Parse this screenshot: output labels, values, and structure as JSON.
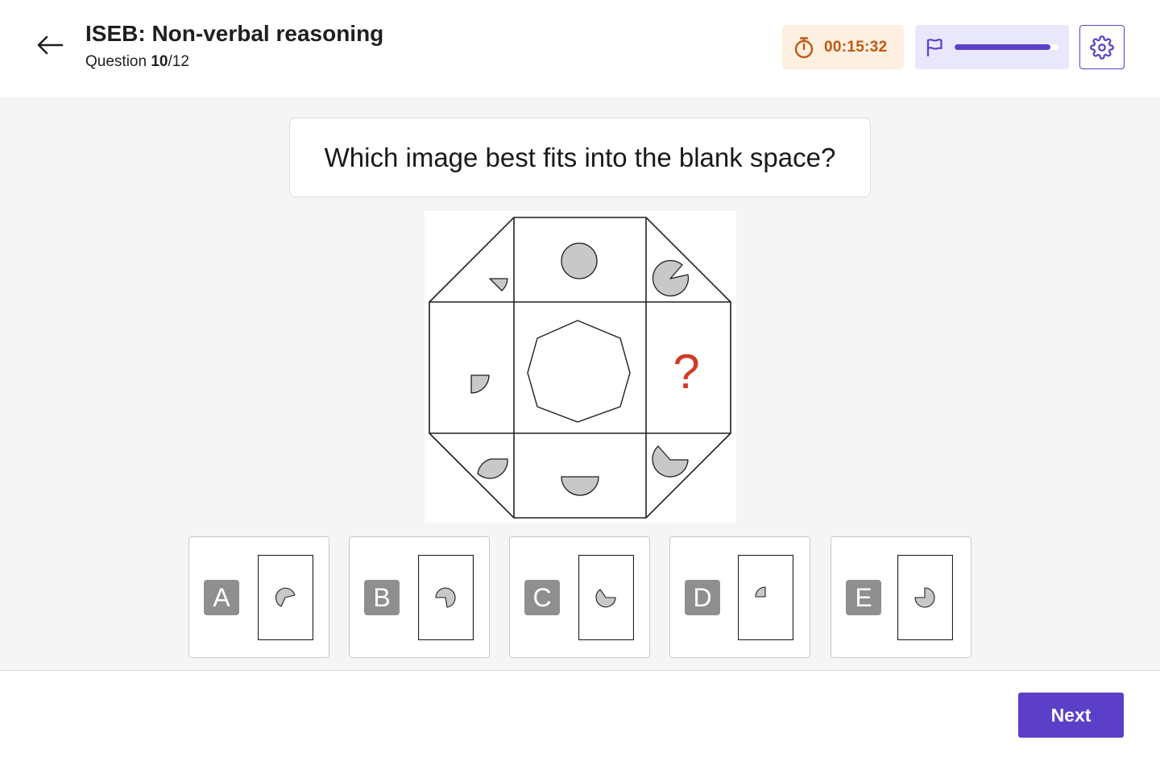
{
  "header": {
    "title": "ISEB: Non-verbal reasoning",
    "question_prefix": "Question",
    "question_current": "10",
    "question_total": "/12",
    "back_icon": "arrow-left-icon",
    "timer_icon": "stopwatch-icon",
    "timer": "00:15:32",
    "flag_icon": "flag-icon",
    "progress": 0.92,
    "settings_icon": "gear-icon"
  },
  "question": {
    "text": "Which image best fits into the blank space?",
    "missing_marker": "?"
  },
  "options": [
    {
      "letter": "A"
    },
    {
      "letter": "B"
    },
    {
      "letter": "C"
    },
    {
      "letter": "D"
    },
    {
      "letter": "E"
    }
  ],
  "footer": {
    "next_label": "Next"
  },
  "colors": {
    "accent": "#5b3fc9",
    "timer_bg": "#fdf0e1",
    "timer_text": "#c2570f",
    "progress_bg": "#e9e7fb",
    "shape_fill": "#c8c8c8",
    "question_mark": "#d23a26",
    "option_letter_bg": "#8f8f8f"
  }
}
